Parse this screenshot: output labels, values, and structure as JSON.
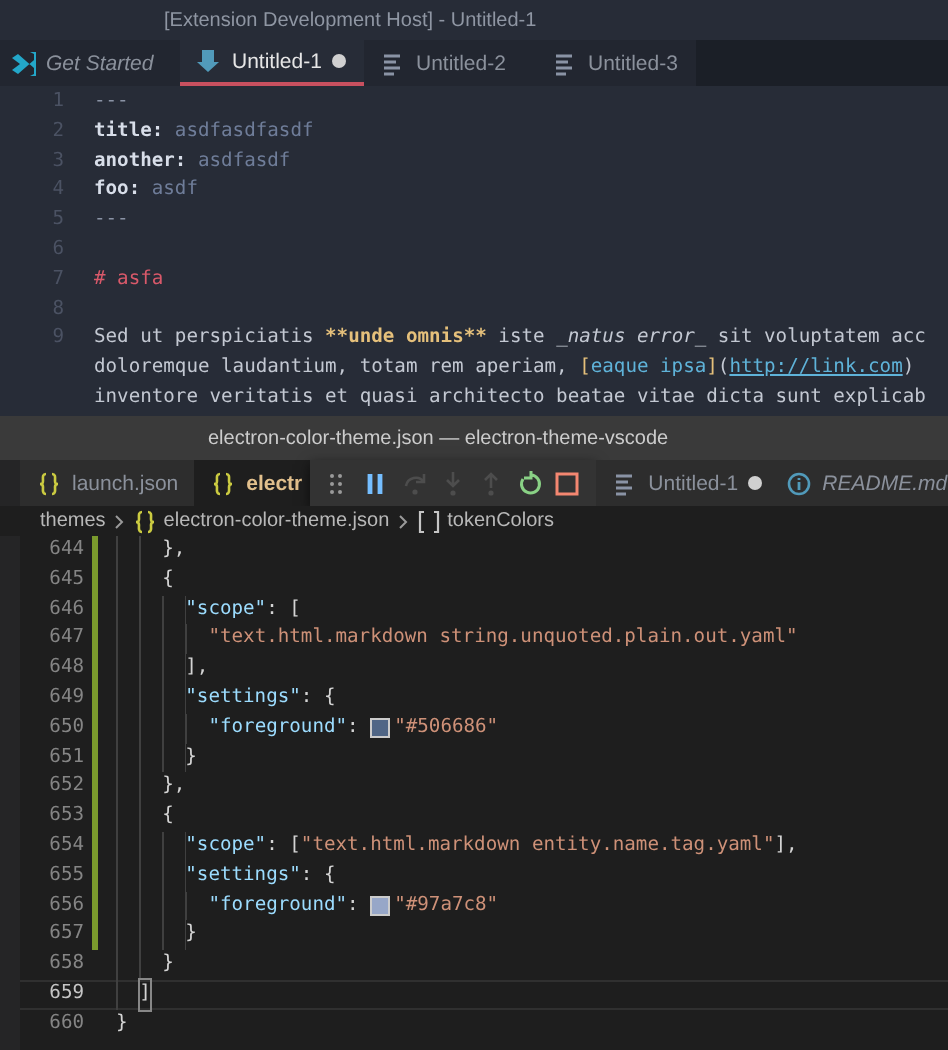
{
  "top_window": {
    "title": "[Extension Development Host] - Untitled-1",
    "tabs": [
      {
        "label": "Get Started",
        "kind": "logo",
        "selected": false,
        "preview": true,
        "modified": false
      },
      {
        "label": "Untitled-1",
        "kind": "markdown",
        "selected": true,
        "preview": false,
        "modified": true
      },
      {
        "label": "Untitled-2",
        "kind": "text",
        "selected": false,
        "preview": false,
        "modified": false
      },
      {
        "label": "Untitled-3",
        "kind": "text",
        "selected": false,
        "preview": false,
        "modified": false
      }
    ],
    "editor": {
      "lines": [
        {
          "number": "1",
          "tokens": [
            {
              "text": "---",
              "kind": "fence"
            }
          ]
        },
        {
          "number": "2",
          "tokens": [
            {
              "text": "title:",
              "kind": "key"
            },
            {
              "text": " asdfasdfasdf",
              "kind": "value"
            }
          ]
        },
        {
          "number": "3",
          "tokens": [
            {
              "text": "another:",
              "kind": "key"
            },
            {
              "text": " asdfasdf",
              "kind": "value"
            }
          ]
        },
        {
          "number": "4",
          "tokens": [
            {
              "text": "foo:",
              "kind": "key"
            },
            {
              "text": " asdf",
              "kind": "value"
            }
          ]
        },
        {
          "number": "5",
          "tokens": [
            {
              "text": "---",
              "kind": "fence"
            }
          ]
        },
        {
          "number": "6"
        },
        {
          "number": "7",
          "tokens": [
            {
              "text": "# asfa",
              "kind": "heading"
            }
          ]
        },
        {
          "number": "8"
        },
        {
          "number": "9",
          "tokens": [
            {
              "text": "Sed ut perspiciatis ",
              "kind": "plain"
            },
            {
              "text": "**unde omnis**",
              "kind": "bold"
            },
            {
              "text": " iste ",
              "kind": "plain"
            },
            {
              "text": "_natus error_",
              "kind": "italic"
            },
            {
              "text": " sit voluptatem acc",
              "kind": "plain"
            }
          ]
        },
        {
          "tokens": [
            {
              "text": "doloremque laudantium, totam rem aperiam, ",
              "kind": "plain"
            },
            {
              "text": "[",
              "kind": "bracket"
            },
            {
              "text": "eaque ipsa",
              "kind": "link"
            },
            {
              "text": "]",
              "kind": "bracket"
            },
            {
              "text": "(",
              "kind": "plain"
            },
            {
              "text": "http://link.com",
              "kind": "url"
            },
            {
              "text": ")",
              "kind": "plain"
            }
          ]
        },
        {
          "tokens": [
            {
              "text": "inventore veritatis et quasi architecto beatae vitae dicta sunt explicab",
              "kind": "plain"
            }
          ]
        }
      ]
    }
  },
  "bottom_window": {
    "title": "electron-color-theme.json — electron-theme-vscode",
    "tabs": [
      {
        "label": "launch.json",
        "kind": "json",
        "selected": false,
        "preview": false,
        "modified": false
      },
      {
        "label": "electr",
        "kind": "json",
        "selected": true,
        "preview": false,
        "modified": false
      },
      {
        "label": "Untitled-1",
        "kind": "text",
        "selected": false,
        "preview": false,
        "modified": true
      },
      {
        "label": "README.md",
        "kind": "info",
        "selected": false,
        "preview": true,
        "modified": false
      }
    ],
    "debug_toolbar": [
      {
        "kind": "grip",
        "disabled": false
      },
      {
        "kind": "pause",
        "disabled": false
      },
      {
        "kind": "step-over",
        "disabled": true
      },
      {
        "kind": "step-into",
        "disabled": true
      },
      {
        "kind": "step-out",
        "disabled": true
      },
      {
        "kind": "restart",
        "disabled": false
      },
      {
        "kind": "stop",
        "disabled": false
      }
    ],
    "breadcrumbs": [
      {
        "label": "themes",
        "kind": "folder"
      },
      {
        "label": "electron-color-theme.json",
        "kind": "json"
      },
      {
        "label": "tokenColors",
        "kind": "array"
      }
    ],
    "editor": {
      "lines": [
        {
          "number": "644",
          "modified": true,
          "current": false,
          "tokens": [
            {
              "text": "    },",
              "kind": "punct"
            }
          ]
        },
        {
          "number": "645",
          "modified": true,
          "current": false,
          "tokens": [
            {
              "text": "    {",
              "kind": "punct"
            }
          ]
        },
        {
          "number": "646",
          "modified": true,
          "current": false,
          "tokens": [
            {
              "text": "      \"scope\"",
              "kind": "prop"
            },
            {
              "text": ": [",
              "kind": "punct"
            }
          ]
        },
        {
          "number": "647",
          "modified": true,
          "current": false,
          "tokens": [
            {
              "text": "        \"text.html.markdown string.unquoted.plain.out.yaml\"",
              "kind": "string"
            }
          ]
        },
        {
          "number": "648",
          "modified": true,
          "current": false,
          "tokens": [
            {
              "text": "      ],",
              "kind": "punct"
            }
          ]
        },
        {
          "number": "649",
          "modified": true,
          "current": false,
          "tokens": [
            {
              "text": "      \"settings\"",
              "kind": "prop"
            },
            {
              "text": ": {",
              "kind": "punct"
            }
          ]
        },
        {
          "number": "650",
          "modified": true,
          "current": false,
          "tokens": [
            {
              "text": "        \"foreground\"",
              "kind": "prop"
            },
            {
              "text": ": ",
              "kind": "punct"
            },
            {
              "kind": "swatch",
              "color": "#506686"
            },
            {
              "text": "\"#506686\"",
              "kind": "string"
            }
          ]
        },
        {
          "number": "651",
          "modified": true,
          "current": false,
          "tokens": [
            {
              "text": "      }",
              "kind": "punct"
            }
          ]
        },
        {
          "number": "652",
          "modified": true,
          "current": false,
          "tokens": [
            {
              "text": "    },",
              "kind": "punct"
            }
          ]
        },
        {
          "number": "653",
          "modified": true,
          "current": false,
          "tokens": [
            {
              "text": "    {",
              "kind": "punct"
            }
          ]
        },
        {
          "number": "654",
          "modified": true,
          "current": false,
          "tokens": [
            {
              "text": "      \"scope\"",
              "kind": "prop"
            },
            {
              "text": ": [",
              "kind": "punct"
            },
            {
              "text": "\"text.html.markdown entity.name.tag.yaml\"",
              "kind": "string"
            },
            {
              "text": "],",
              "kind": "punct"
            }
          ]
        },
        {
          "number": "655",
          "modified": true,
          "current": false,
          "tokens": [
            {
              "text": "      \"settings\"",
              "kind": "prop"
            },
            {
              "text": ": {",
              "kind": "punct"
            }
          ]
        },
        {
          "number": "656",
          "modified": true,
          "current": false,
          "tokens": [
            {
              "text": "        \"foreground\"",
              "kind": "prop"
            },
            {
              "text": ": ",
              "kind": "punct"
            },
            {
              "kind": "swatch",
              "color": "#97a7c8"
            },
            {
              "text": "\"#97a7c8\"",
              "kind": "string"
            }
          ]
        },
        {
          "number": "657",
          "modified": true,
          "current": false,
          "tokens": [
            {
              "text": "      }",
              "kind": "punct"
            }
          ]
        },
        {
          "number": "658",
          "modified": false,
          "current": false,
          "tokens": [
            {
              "text": "    }",
              "kind": "punct"
            }
          ]
        },
        {
          "number": "659",
          "modified": false,
          "current": true,
          "tokens": [
            {
              "text": "  ]",
              "kind": "punct"
            }
          ]
        },
        {
          "number": "660",
          "modified": false,
          "current": false,
          "tokens": [
            {
              "text": "}",
              "kind": "punct"
            }
          ]
        }
      ]
    }
  }
}
